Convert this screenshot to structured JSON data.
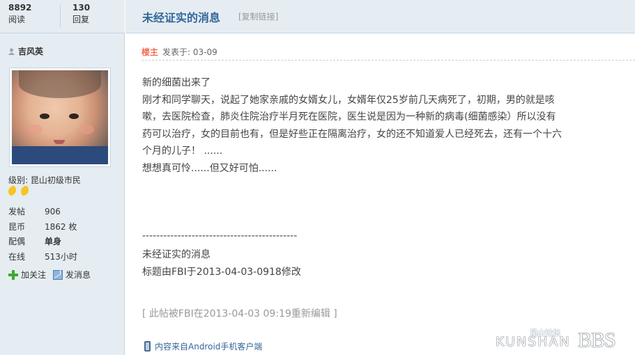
{
  "stats": {
    "views_num": "8892",
    "views_label": "阅读",
    "replies_num": "130",
    "replies_label": "回复"
  },
  "thread": {
    "title": "未经证实的消息",
    "copy_link": "[复制链接]"
  },
  "author": {
    "name": "吉风英",
    "level": "级别: 昆山初级市民",
    "info": [
      {
        "key": "发帖",
        "value": "906"
      },
      {
        "key": "昆币",
        "value": "1862 枚"
      },
      {
        "key": "配偶",
        "value": "单身"
      },
      {
        "key": "在线",
        "value": "513小时"
      }
    ],
    "follow_label": "加关注",
    "message_label": "发消息"
  },
  "post": {
    "floor": "楼主",
    "posted": "发表于: 03-09",
    "body": [
      "新的细菌出来了",
      "刚才和同学聊天，说起了她家亲戚的女婿女儿，女婿年仅25岁前几天病死了，初期，男的就是咳",
      "嗽，去医院检查，肺炎住院治疗半月死在医院，医生说是因为一种新的病毒(细菌感染）所以没有",
      "药可以治疗，女的目前也有，但是好些正在隔离治疗，女的还不知道爱人已经死去，还有一个十六",
      "个月的儿子！ ......",
      "想想真可怜......但又好可怕......"
    ],
    "separator": "--------------------------------------------",
    "footer": [
      "未经证实的消息",
      "标题由FBI于2013-04-03-0918修改"
    ],
    "edited": "[ 此帖被FBI在2013-04-03 09:19重新编辑 ]",
    "mobile": "内容来自Android手机客户端"
  },
  "watermark": {
    "cn": "昆山论坛",
    "en": "KUNSHAN",
    "bbs": "BBS"
  },
  "colors": {
    "sidebar_bg": "#e5edf2",
    "border": "#c2d5e3",
    "title": "#336699",
    "floor": "#f26c4f"
  },
  "icons": [
    "user-icon",
    "moon-icon",
    "plus-icon",
    "mail-icon",
    "phone-icon"
  ]
}
